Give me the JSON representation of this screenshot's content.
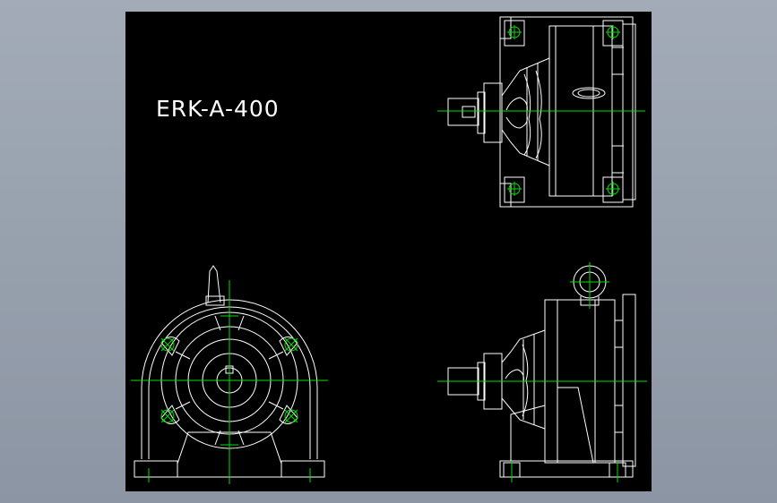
{
  "drawing": {
    "title_text": "ERK-A-400",
    "colors": {
      "background": "#000000",
      "frame": "#9aa2af",
      "outline": "#ffffff",
      "centerline": "#00e000"
    }
  }
}
